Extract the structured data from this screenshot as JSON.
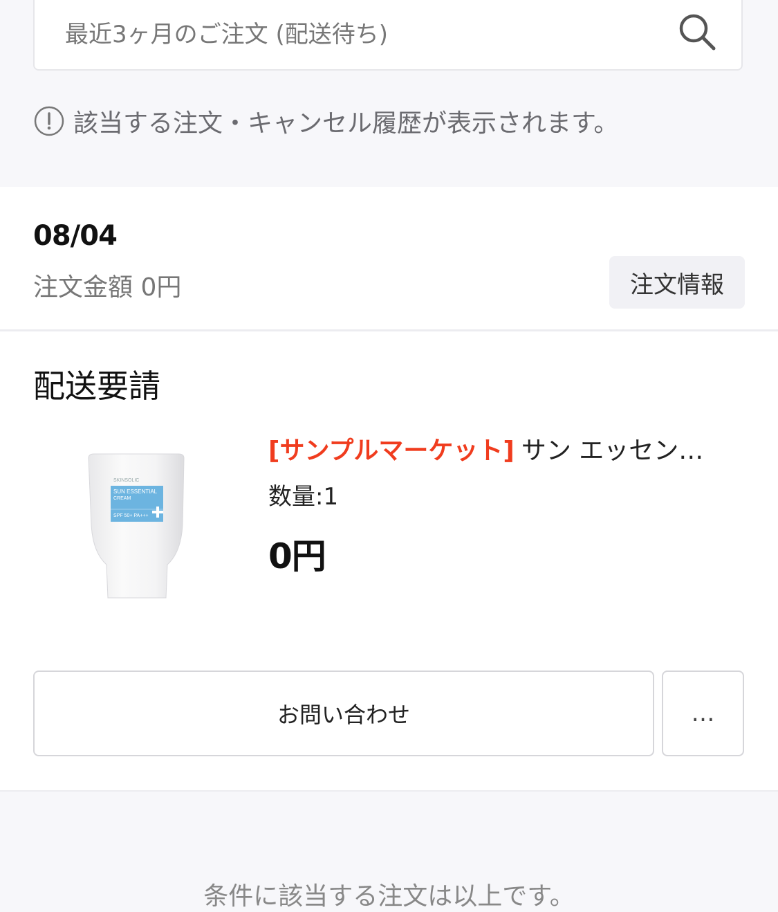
{
  "search": {
    "text": "最近3ヶ月のご注文 (配送待ち)",
    "icon": "search-icon"
  },
  "notice": {
    "icon": "exclamation-circle-icon",
    "text": "該当する注文・キャンセル履歴が表示されます。"
  },
  "order": {
    "date": "08/04",
    "amount": "注文金額 0円",
    "info_button": "注文情報",
    "status": "配送要請",
    "product": {
      "shop": "[サンプルマーケット]",
      "name": "サン エッセンシャル クリーム",
      "quantity": "数量:1",
      "price": "0円",
      "image_brand": "SKINSOLIC",
      "image_title_1": "SUN ESSENTIAL",
      "image_title_2": "CREAM",
      "image_spf": "SPF 50+ PA+++"
    },
    "contact_button": "お問い合わせ",
    "more_button": "…"
  },
  "footer": {
    "end_text": "条件に該当する注文は以上です。"
  },
  "colors": {
    "shop_accent": "#f03c1e",
    "background": "#f7f7fa"
  }
}
